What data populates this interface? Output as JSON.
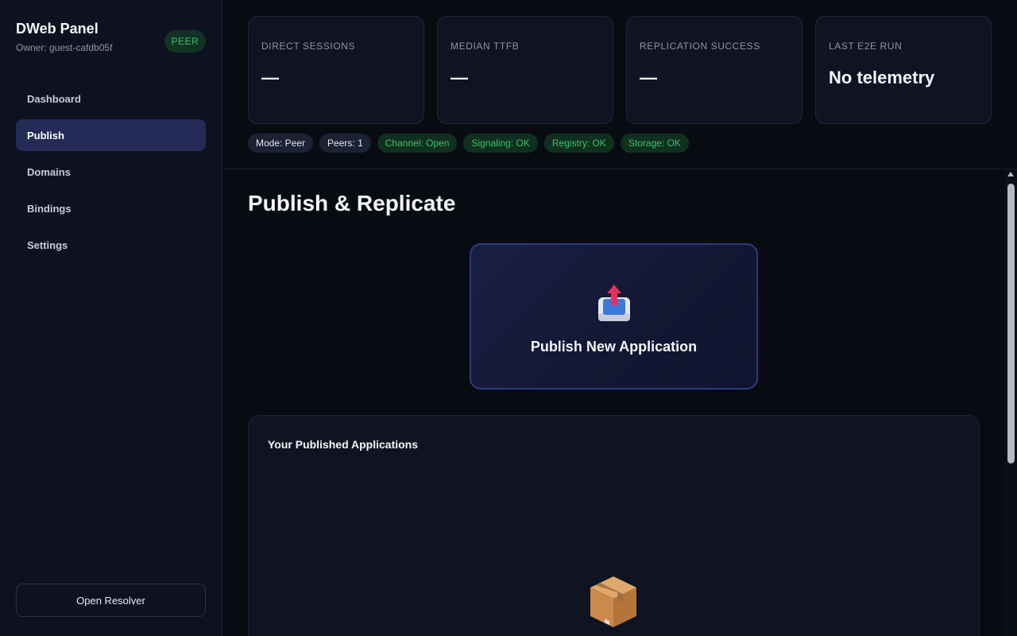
{
  "sidebar": {
    "title": "DWeb Panel",
    "owner": "Owner: guest-cafdb05f",
    "role_badge": "PEER",
    "nav": [
      {
        "label": "Dashboard",
        "active": false
      },
      {
        "label": "Publish",
        "active": true
      },
      {
        "label": "Domains",
        "active": false
      },
      {
        "label": "Bindings",
        "active": false
      },
      {
        "label": "Settings",
        "active": false
      }
    ],
    "resolver_button": "Open Resolver"
  },
  "stats": [
    {
      "label": "DIRECT SESSIONS",
      "value": "—"
    },
    {
      "label": "MEDIAN TTFB",
      "value": "—"
    },
    {
      "label": "REPLICATION SUCCESS",
      "value": "—"
    },
    {
      "label": "LAST E2E RUN",
      "value": "No telemetry"
    }
  ],
  "status_pills": [
    {
      "text": "Mode: Peer",
      "status": "neutral"
    },
    {
      "text": "Peers: 1",
      "status": "neutral"
    },
    {
      "text": "Channel: Open",
      "status": "ok"
    },
    {
      "text": "Signaling: OK",
      "status": "ok"
    },
    {
      "text": "Registry: OK",
      "status": "ok"
    },
    {
      "text": "Storage: OK",
      "status": "ok"
    }
  ],
  "main": {
    "title": "Publish & Replicate",
    "publish_card": {
      "label": "Publish New Application",
      "icon": "upload-tray-icon"
    },
    "apps_panel": {
      "title": "Your Published Applications",
      "empty_icon": "package-box-icon"
    }
  },
  "colors": {
    "background": "#090b12",
    "sidebar": "#0e1220",
    "accent": "#222a55",
    "ok_text": "#3fbf6f",
    "ok_bg": "#10301f"
  }
}
